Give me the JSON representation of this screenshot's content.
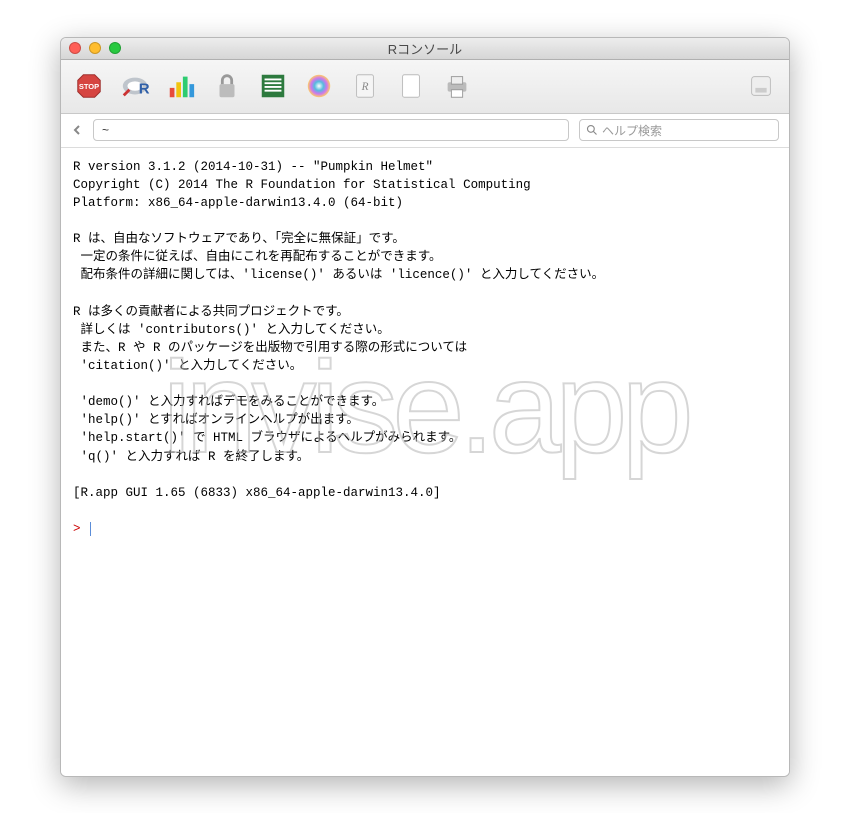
{
  "window": {
    "title": "Rコンソール"
  },
  "toolbar": {
    "icons": [
      "stop",
      "r-logo",
      "barchart",
      "lock",
      "lines",
      "color",
      "rdoc",
      "doc",
      "print",
      "drive"
    ]
  },
  "filter": {
    "workingdir": "~",
    "search_placeholder": "ヘルプ検索"
  },
  "console": {
    "lines": [
      "R version 3.1.2 (2014-10-31) -- \"Pumpkin Helmet\"",
      "Copyright (C) 2014 The R Foundation for Statistical Computing",
      "Platform: x86_64-apple-darwin13.4.0 (64-bit)",
      "",
      "R は、自由なソフトウェアであり、「完全に無保証」です。",
      " 一定の条件に従えば、自由にこれを再配布することができます。",
      " 配布条件の詳細に関しては、'license()' あるいは 'licence()' と入力してください。",
      "",
      "R は多くの貢献者による共同プロジェクトです。",
      " 詳しくは 'contributors()' と入力してください。",
      " また、R や R のパッケージを出版物で引用する際の形式については",
      " 'citation()' と入力してください。",
      "",
      " 'demo()' と入力すればデモをみることができます。",
      " 'help()' とすればオンラインヘルプが出ます。",
      " 'help.start()' で HTML ブラウザによるヘルプがみられます。",
      " 'q()' と入力すれば R を終了します。",
      "",
      "[R.app GUI 1.65 (6833) x86_64-apple-darwin13.4.0]",
      ""
    ],
    "prompt": ">"
  },
  "watermark": "invise.app"
}
